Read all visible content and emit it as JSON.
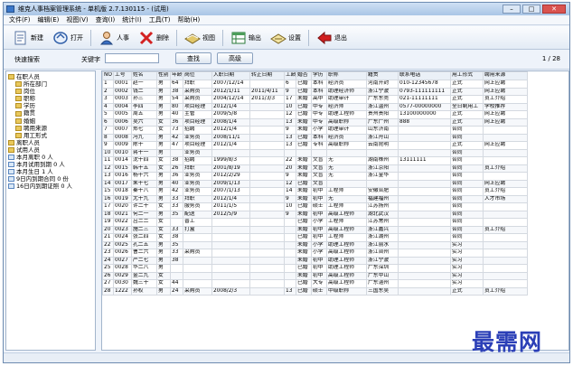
{
  "window": {
    "title": "维克人事档案管理系统 - 单机版 2.7.130115 - (试用)",
    "controls": [
      "–",
      "□",
      "✕"
    ]
  },
  "menu": [
    "文件(F)",
    "编辑(E)",
    "视图(V)",
    "查询(I)",
    "统计(I)",
    "工具(T)",
    "帮助(H)"
  ],
  "toolbar": [
    {
      "id": "new",
      "label": "新建",
      "icon": "new-icon"
    },
    {
      "id": "open",
      "label": "打开",
      "icon": "open-icon"
    },
    {
      "id": "person",
      "label": "人事",
      "icon": "person-icon"
    },
    {
      "id": "delete",
      "label": "删除",
      "icon": "delete-icon"
    },
    {
      "id": "view",
      "label": "视图",
      "icon": "view-icon"
    },
    {
      "id": "export",
      "label": "输出",
      "icon": "export-icon"
    },
    {
      "id": "settings",
      "label": "设置",
      "icon": "settings-icon"
    },
    {
      "id": "exit",
      "label": "退出",
      "icon": "exit-icon"
    }
  ],
  "search": {
    "quick_label": "快速搜索",
    "keyword_label": "关键字",
    "find_label": "查找",
    "advanced_label": "高级",
    "page": "1 / 28"
  },
  "tree": [
    {
      "label": "在职人员",
      "level": 0,
      "icon": "folder"
    },
    {
      "label": "所在部门",
      "level": 1,
      "icon": "folder"
    },
    {
      "label": "岗位",
      "level": 1,
      "icon": "folder"
    },
    {
      "label": "职称",
      "level": 1,
      "icon": "folder"
    },
    {
      "label": "学历",
      "level": 1,
      "icon": "folder"
    },
    {
      "label": "籍贯",
      "level": 1,
      "icon": "folder"
    },
    {
      "label": "婚姻",
      "level": 1,
      "icon": "folder"
    },
    {
      "label": "聘用来源",
      "level": 1,
      "icon": "folder"
    },
    {
      "label": "用工形式",
      "level": 1,
      "icon": "folder"
    },
    {
      "label": "离职人员",
      "level": 0,
      "icon": "folder"
    },
    {
      "label": "试用人员",
      "level": 0,
      "icon": "folder"
    },
    {
      "label": "本月离职 0 人",
      "level": 0,
      "icon": "doc"
    },
    {
      "label": "本月试用到期 0 人",
      "level": 0,
      "icon": "doc"
    },
    {
      "label": "本月生日 1 人",
      "level": 0,
      "icon": "doc"
    },
    {
      "label": "9日内到期合同 0 份",
      "level": 0,
      "icon": "doc"
    },
    {
      "label": "16日内到期证照 0 人",
      "level": 0,
      "icon": "doc"
    }
  ],
  "table": {
    "headers": [
      "NO",
      "工号",
      "姓名",
      "性别",
      "年龄",
      "岗位",
      "入职日期",
      "转正日期",
      "工龄",
      "婚否",
      "学历",
      "职称",
      "籍贯",
      "联系电话",
      "用工形式",
      "聘用来源"
    ],
    "rows": [
      [
        "1",
        "0001",
        "赵一",
        "男",
        "64",
        "拜职",
        "2007/12/14",
        "",
        "6",
        "已婚",
        "本科",
        "经济员",
        "河南开封",
        "010-12345678",
        "正式",
        "网上应聘"
      ],
      [
        "2",
        "0002",
        "钱二",
        "男",
        "38",
        "采购员",
        "2012/1/11",
        "2011/4/11",
        "9",
        "已婚",
        "本科",
        "助理经济师",
        "浙江宁波",
        "0793-111111111",
        "正式",
        "网上应聘"
      ],
      [
        "3",
        "0003",
        "孙三",
        "男",
        "54",
        "采购员",
        "2004/12/14",
        "2011/3/3",
        "17",
        "未婚",
        "高中",
        "助理审计",
        "广东东莞",
        "021-11111111",
        "正式",
        "员工介绍"
      ],
      [
        "4",
        "0004",
        "李四",
        "男",
        "80",
        "项目经理",
        "2012/1/4",
        "",
        "10",
        "已婚",
        "中专",
        "经济师",
        "浙江温州",
        "0577-00000000",
        "全日制用工",
        "学校推荐"
      ],
      [
        "5",
        "0005",
        "周五",
        "男",
        "40",
        "主管",
        "2009/5/8",
        "",
        "12",
        "已婚",
        "中专",
        "助理工程师",
        "贵州贵阳",
        "13100000000",
        "正式",
        "网上应聘"
      ],
      [
        "6",
        "0006",
        "吴六",
        "女",
        "36",
        "项目经理",
        "2008/1/4",
        "",
        "13",
        "未婚",
        "中专",
        "高级职称",
        "广东广州",
        "888",
        "正式",
        "网上应聘"
      ],
      [
        "7",
        "0007",
        "郑七",
        "女",
        "73",
        "招聘",
        "2012/1/4",
        "",
        "9",
        "未婚",
        "小学",
        "助理审计",
        "山东济南",
        "",
        "合同",
        ""
      ],
      [
        "8",
        "0008",
        "冯九",
        "男",
        "42",
        "业务员",
        "2008/11/1",
        "",
        "13",
        "已婚",
        "本科",
        "经济员",
        "浙江舟山",
        "",
        "合同",
        ""
      ],
      [
        "9",
        "0009",
        "陈十",
        "男",
        "47",
        "项目经理",
        "2012/1/4",
        "",
        "13",
        "已婚",
        "专科",
        "高级职称",
        "云南昆明",
        "",
        "正式",
        "网上应聘"
      ],
      [
        "10",
        "0010",
        "蒋十一",
        "男",
        "",
        "业务员",
        "",
        "",
        "",
        "",
        "",
        "",
        "",
        "",
        "合同",
        ""
      ],
      [
        "11",
        "0014",
        "沈十四",
        "女",
        "38",
        "招聘",
        "1999/8/3",
        "",
        "22",
        "未婚",
        "文盲",
        "无",
        "湖南株州",
        "13111111",
        "合同",
        ""
      ],
      [
        "12",
        "0015",
        "韩十五",
        "女",
        "26",
        "拜职",
        "2001/8/19",
        "",
        "20",
        "未婚",
        "文盲",
        "无",
        "浙江京阳",
        "",
        "合同",
        "员工介绍"
      ],
      [
        "13",
        "0016",
        "杨十六",
        "男",
        "36",
        "业务员",
        "2012/2/29",
        "",
        "9",
        "未婚",
        "文盲",
        "无",
        "浙江金华",
        "",
        "合同",
        ""
      ],
      [
        "14",
        "0017",
        "朱十七",
        "男",
        "40",
        "业务员",
        "2009/1/13",
        "",
        "12",
        "已婚",
        "文盲",
        "",
        "",
        "",
        "合同",
        "网上应聘"
      ],
      [
        "15",
        "0018",
        "秦十八",
        "男",
        "42",
        "业务员",
        "2007/1/13",
        "",
        "14",
        "未婚",
        "初中",
        "工程师",
        "安徽合肥",
        "",
        "合同",
        "员工介绍"
      ],
      [
        "16",
        "0019",
        "尤十九",
        "男",
        "33",
        "拜职",
        "2012/1/4",
        "",
        "9",
        "未婚",
        "初中",
        "无",
        "福建福州",
        "",
        "合同",
        "人才市场"
      ],
      [
        "17",
        "0020",
        "许二十",
        "女",
        "33",
        "服务员",
        "2011/1/5",
        "",
        "10",
        "已婚",
        "硕士",
        "工程师",
        "江苏扬州",
        "",
        "合同",
        ""
      ],
      [
        "18",
        "0021",
        "何二一",
        "男",
        "35",
        "配送",
        "2012/5/9",
        "",
        "9",
        "未婚",
        "初中",
        "高级工程师",
        "湖北武汉",
        "",
        "合同",
        ""
      ],
      [
        "19",
        "0022",
        "吕二二",
        "女",
        "",
        "普工",
        "",
        "",
        "",
        "已婚",
        "小学",
        "工程师",
        "江苏常州",
        "",
        "合同",
        ""
      ],
      [
        "20",
        "0023",
        "施二三",
        "女",
        "33",
        "打盒",
        "",
        "",
        "",
        "未婚",
        "初中",
        "高级工程师",
        "浙江嘉兴",
        "",
        "合同",
        "员工介绍"
      ],
      [
        "21",
        "0024",
        "张二四",
        "女",
        "38",
        "",
        "",
        "",
        "",
        "已婚",
        "初中",
        "工程师",
        "浙江湖州",
        "",
        "合同",
        ""
      ],
      [
        "22",
        "0025",
        "孔二五",
        "男",
        "35",
        "",
        "",
        "",
        "",
        "未婚",
        "小学",
        "助理工程师",
        "浙江丽水",
        "",
        "实习",
        ""
      ],
      [
        "23",
        "0026",
        "曹二六",
        "男",
        "33",
        "采购员",
        "",
        "",
        "",
        "未婚",
        "小学",
        "高级工程师",
        "浙江台州",
        "",
        "实习",
        ""
      ],
      [
        "24",
        "0027",
        "严二七",
        "男",
        "38",
        "",
        "",
        "",
        "",
        "未婚",
        "初中",
        "助理工程师",
        "浙江宁波",
        "",
        "实习",
        ""
      ],
      [
        "25",
        "0028",
        "华二八",
        "男",
        "",
        "",
        "",
        "",
        "",
        "已婚",
        "初中",
        "助理工程师",
        "广东深圳",
        "",
        "实习",
        ""
      ],
      [
        "26",
        "0029",
        "金二九",
        "女",
        "",
        "",
        "",
        "",
        "",
        "未婚",
        "初中",
        "高级工程师",
        "广东中山",
        "",
        "实习",
        ""
      ],
      [
        "27",
        "0030",
        "魏三十",
        "女",
        "44",
        "",
        "",
        "",
        "",
        "已婚",
        "大专",
        "高级工程师",
        "广东湛州",
        "",
        "实习",
        ""
      ],
      [
        "28",
        "1222",
        "孙权",
        "男",
        "24",
        "采购员",
        "2008/2/3",
        "",
        "13",
        "已婚",
        "硕士",
        "中级职称",
        "三国东吴",
        "",
        "正式",
        "员工介绍"
      ]
    ]
  },
  "watermark": "最需网"
}
